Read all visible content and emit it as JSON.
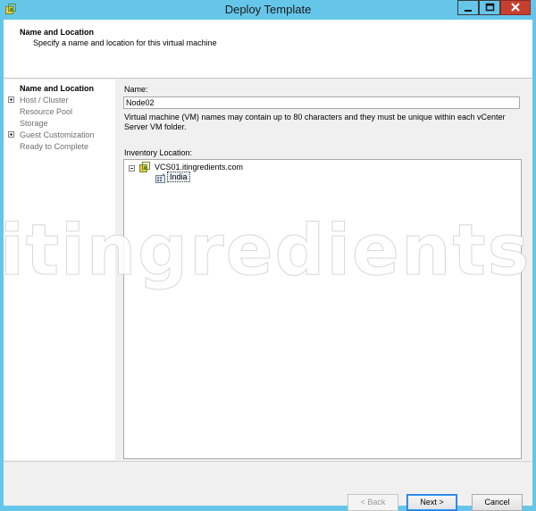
{
  "window": {
    "title": "Deploy Template"
  },
  "header": {
    "title": "Name and Location",
    "subtitle": "Specify a name and location for this virtual machine"
  },
  "nav": {
    "items": [
      {
        "label": "Name and Location",
        "state": "active",
        "expander": "none"
      },
      {
        "label": "Host / Cluster",
        "state": "disabled",
        "expander": "plus"
      },
      {
        "label": "Resource Pool",
        "state": "disabled",
        "expander": "none"
      },
      {
        "label": "Storage",
        "state": "disabled",
        "expander": "none"
      },
      {
        "label": "Guest Customization",
        "state": "disabled",
        "expander": "plus"
      },
      {
        "label": "Ready to Complete",
        "state": "disabled",
        "expander": "none"
      }
    ]
  },
  "form": {
    "name_label": "Name:",
    "name_value": "Node02",
    "help_text": "Virtual machine (VM) names may contain up to 80 characters and they must be unique within each vCenter Server VM folder.",
    "inventory_label": "Inventory Location:"
  },
  "tree": {
    "root": {
      "label": "VCS01.itingredients.com",
      "icon": "vcenter-icon",
      "expanded": true
    },
    "child": {
      "label": "India",
      "icon": "datacenter-icon",
      "selected": true
    }
  },
  "footer": {
    "back_label": "< Back",
    "next_label": "Next >",
    "cancel_label": "Cancel"
  },
  "watermark": "itingredients.com",
  "colors": {
    "titlebar": "#66c6ea",
    "close_button": "#c7402f",
    "default_button_border": "#3399ff"
  }
}
